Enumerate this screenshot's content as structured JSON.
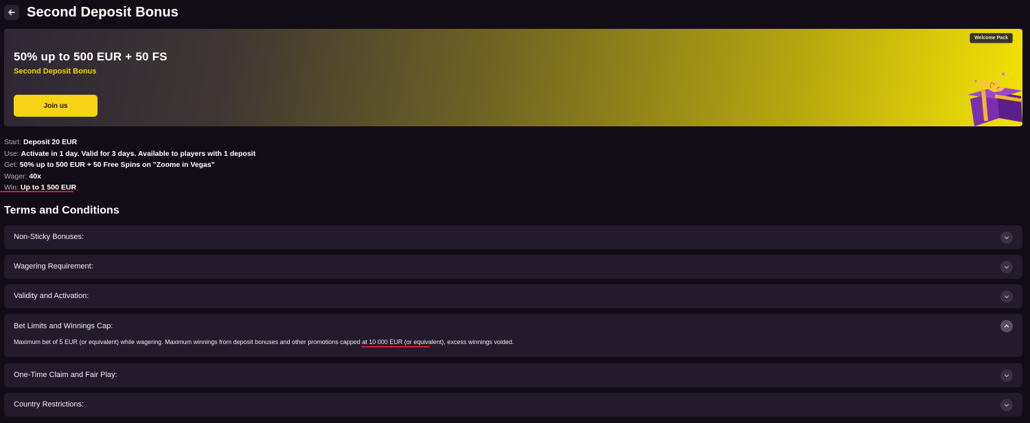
{
  "header": {
    "title": "Second Deposit Bonus",
    "back_icon": "arrow-left-icon"
  },
  "banner": {
    "headline": "50% up to 500 EUR + 50 FS",
    "subtitle": "Second Deposit Bonus",
    "button_label": "Join us",
    "badge": "Welcome Pack",
    "image_icon": "gift-box-icon",
    "colors": {
      "accent": "#f7d416",
      "subtitle": "#f5d800"
    }
  },
  "info": [
    {
      "key": "Start:",
      "value": "Deposit 20 EUR"
    },
    {
      "key": "Use:",
      "value": "Activate in 1 day. Valid for 3 days. Available to players with 1 deposit"
    },
    {
      "key": "Get:",
      "value": "50% up to 500 EUR + 50 Free Spins on \"Zoome in Vegas\""
    },
    {
      "key": "Wager:",
      "value": "40x"
    },
    {
      "key": "Win:",
      "value": "Up to 1 500 EUR"
    }
  ],
  "terms": {
    "title": "Terms and Conditions",
    "items": [
      {
        "label": "Non-Sticky Bonuses:",
        "expanded": false
      },
      {
        "label": "Wagering Requirement:",
        "expanded": false
      },
      {
        "label": "Validity and Activation:",
        "expanded": false
      },
      {
        "label": "Bet Limits and Winnings Cap:",
        "expanded": true,
        "content": "Maximum bet of 5 EUR (or equivalent) while wagering. Maximum winnings from deposit bonuses and other promotions capped at 10 000 EUR (or equivalent), excess winnings voided."
      },
      {
        "label": "One-Time Claim and Fair Play:",
        "expanded": false
      },
      {
        "label": "Country Restrictions:",
        "expanded": false
      }
    ],
    "toggle_icons": {
      "collapsed": "chevron-down-icon",
      "expanded": "chevron-up-icon"
    }
  },
  "annotations": {
    "underline_color": "#e0182b"
  }
}
